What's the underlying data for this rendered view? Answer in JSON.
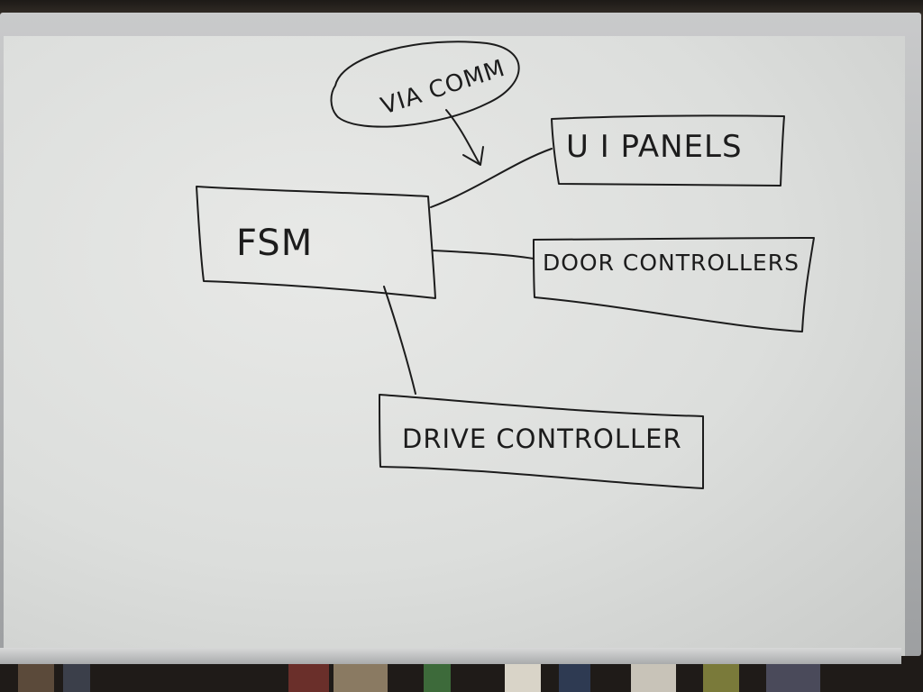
{
  "diagram": {
    "note_label": "VIA COMM",
    "nodes": {
      "fsm": "FSM",
      "ui_panels": "U I PANELS",
      "door_controllers": "DOOR CONTROLLERS",
      "drive_controller": "DRIVE CONTROLLER"
    }
  },
  "colors": {
    "ink": "#1c1c1c",
    "board": "#dcdedc",
    "frame": "#b4b6b8"
  }
}
